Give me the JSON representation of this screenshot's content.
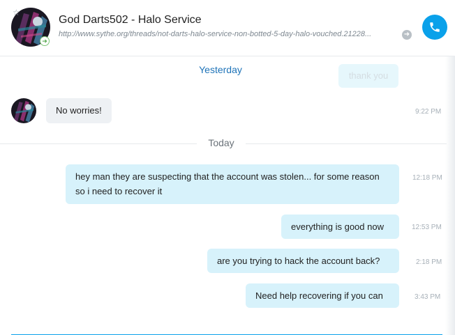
{
  "header": {
    "title": "God Darts502 - Halo Service",
    "link": "http://www.sythe.org/threads/not-darts-halo-service-non-botted-5-day-halo-vouched.21228..."
  },
  "conversation": {
    "days": {
      "yesterday": "Yesterday",
      "today": "Today"
    },
    "faded_message": "thank you",
    "incoming": {
      "text": "No worries!",
      "time": "9:22 PM"
    },
    "outgoing": [
      {
        "text": "hey man they are suspecting that the account was stolen... for some reason so i need to recover it",
        "time": "12:18 PM"
      },
      {
        "text": "everything is good now",
        "time": "12:53 PM"
      },
      {
        "text": "are you trying to hack the account back?",
        "time": "2:18 PM"
      },
      {
        "text": "Need help recovering if you can",
        "time": "3:43 PM"
      }
    ]
  },
  "colors": {
    "accent": "#0aa1ea",
    "out_bubble": "#d7f2fb",
    "in_bubble": "#eef1f4",
    "day_link": "#1e73b8"
  },
  "icons": {
    "favorite": "star-icon",
    "presence": "presence-icon",
    "open_link": "arrow-right-icon",
    "call": "phone-icon"
  }
}
